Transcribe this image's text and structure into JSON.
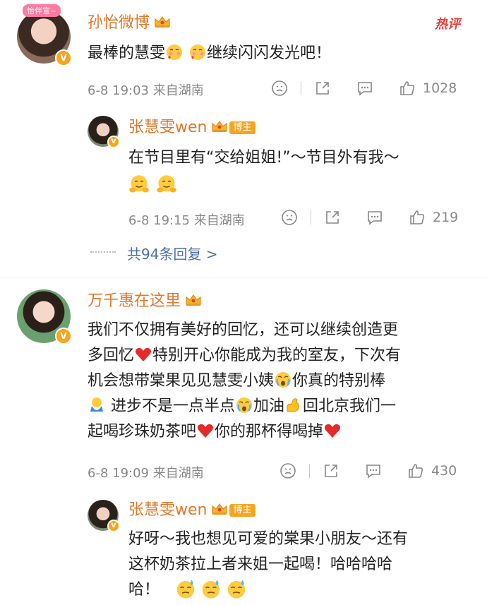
{
  "hot_label": "热评",
  "comments": [
    {
      "user": "孙怡微博",
      "avatar_tag": "怡伴宣~",
      "text": "最棒的慧雯🥰🥰继续闪闪发光吧！",
      "text_main": "最棒的慧雯",
      "text_tail": "继续闪闪发光吧！",
      "time": "6-8 19:03",
      "source": "来自湖南",
      "likes": "1028"
    },
    {
      "user": "张慧雯wen",
      "badge": "博主",
      "text": "在节目里有“交给姐姐!”～节目外有我～",
      "time": "6-8 19:15",
      "source": "来自湖南",
      "likes": "219"
    },
    {
      "replies_label": "共94条回复 >"
    },
    {
      "user": "万千惠在这里",
      "text_l1": "我们不仅拥有美好的回忆，还可以继续创造更",
      "text_l2a": "多回忆",
      "text_l2b": "特别开心你能成为我的室友，下次有",
      "text_l3a": "机会想带棠果见见慧雯小姨",
      "text_l3b": "你真的特别棒",
      "text_l4a": "进步不是一点半点",
      "text_l4b": "加油",
      "text_l4c": "回北京我们一",
      "text_l5a": "起喝珍珠奶茶吧",
      "text_l5b": "你的那杯得喝掉",
      "time": "6-8 19:09",
      "source": "来自湖南",
      "likes": "430"
    },
    {
      "user": "张慧雯wen",
      "badge": "博主",
      "text_l1": "好呀～我也想见可爱的棠果小朋友～还有",
      "text_l2": "这杯奶茶拉上者来姐一起喝！哈哈哈哈",
      "text_l3": "哈！"
    }
  ],
  "colors": {
    "name": "#e0782a",
    "link": "#4a6ea9",
    "hot": "#e8403a",
    "badge": "#f6a51c"
  },
  "icons": [
    "crown-icon",
    "emoji-react-icon",
    "share-icon",
    "comment-icon",
    "like-icon",
    "verified-icon"
  ]
}
